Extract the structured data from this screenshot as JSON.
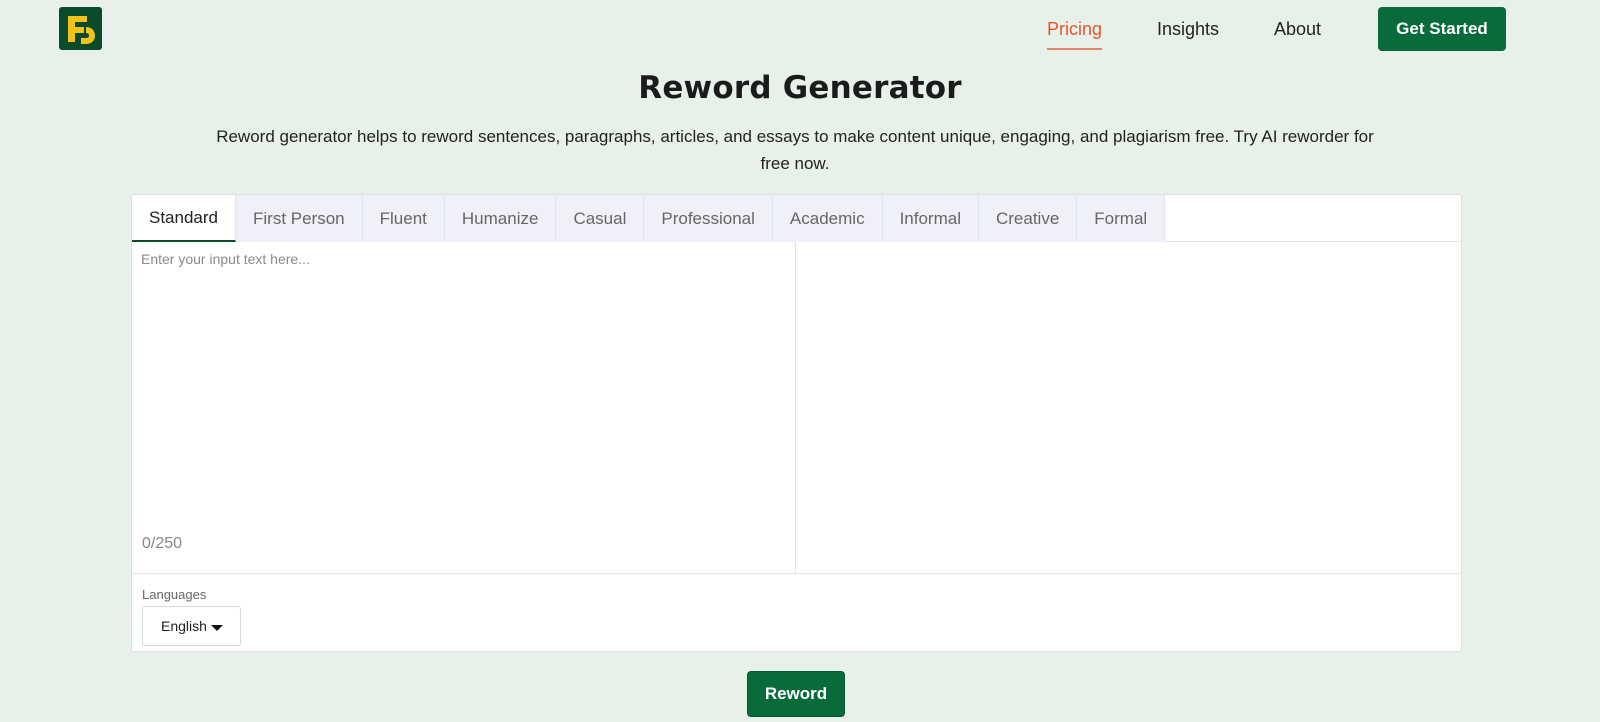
{
  "header": {
    "logo_letters": "FG",
    "nav": [
      {
        "label": "Pricing",
        "active": true
      },
      {
        "label": "Insights",
        "active": false
      },
      {
        "label": "About",
        "active": false
      }
    ],
    "cta_label": "Get Started"
  },
  "hero": {
    "title": "Reword Generator",
    "subtitle": "Reword generator helps to reword sentences, paragraphs, articles, and essays to make content unique, engaging, and plagiarism free. Try AI reworder for free now."
  },
  "editor": {
    "tabs": [
      "Standard",
      "First Person",
      "Fluent",
      "Humanize",
      "Casual",
      "Professional",
      "Academic",
      "Informal",
      "Creative",
      "Formal"
    ],
    "active_tab": "Standard",
    "input_placeholder": "Enter your input text here...",
    "input_value": "",
    "counter": "0/250",
    "languages_label": "Languages",
    "language_selected": "English"
  },
  "actions": {
    "reword_label": "Reword"
  },
  "colors": {
    "page_bg": "#e7f0e9",
    "brand_green": "#0a6b3a",
    "active_nav": "#e4572e",
    "logo_bg": "#0b4a2a",
    "logo_fg": "#f2c318"
  },
  "icons": {
    "logo": "fg-logo-icon",
    "dropdown": "caret-down-icon"
  }
}
